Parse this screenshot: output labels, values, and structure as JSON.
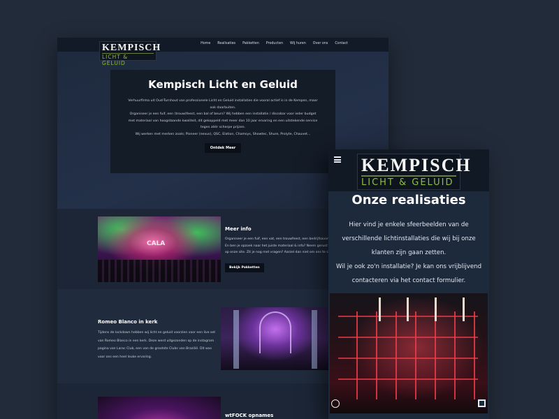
{
  "brand": {
    "logo_top": "KEMPISCH",
    "logo_bottom": "LICHT & GELUID"
  },
  "desktop": {
    "nav": [
      "Home",
      "Realisaties",
      "Pakketten",
      "Producten",
      "Wij huren",
      "Over ons",
      "Contact"
    ],
    "hero": {
      "title": "Kempisch Licht en Geluid",
      "paragraphs": [
        "Verhuurfirma uit Oud-Turnhout van professionele Licht en Geluid installaties die vooral actief is in de Kempen, maar",
        "ook daarbuiten.",
        "Organiseer je een fuif, een (trouw)feest, een bal of beurs? Wij hebben een installatie / discobar voor ieder budget",
        "met materiaal van hoogstaande kwaliteit, dit gekoppeld met meer dan 10 jaar ervaring en een uitstekende service",
        "tegen zéér scherpe prijzen.",
        "Wij werken met merken zoals; Pioneer (nexus), QSC, Elation, Chamsys, Showtec, Shure, Prolyte, Chauvet..."
      ],
      "button": "Ontdek Meer"
    },
    "section1": {
      "stage_text": "CALA",
      "title": "Meer info",
      "paragraphs": [
        "Organiseer je een fuif, een vat, een trouwfeest, een bedrijfsavond...",
        "En ben je opzoek naar het juiste materiaal & info? Neem gerust contact",
        "op onze site. Zit je nog met vragen? Aarzel dan niet om ons te contacteren."
      ],
      "button": "Bekijk Pakketten"
    },
    "section2": {
      "title": "Romeo Blanco in kerk",
      "paragraphs": [
        "Tijdens de lockdown hebben wij licht en geluid voorzien voor een live set",
        "van Romeo Blanco in een kerk. Deze werd uitgezonden op de instagram",
        "pagina van Larac Club, een van de grootste Clubs van Brazilië. Dit was",
        "voor ons een heel leuke ervaring."
      ]
    },
    "section3": {
      "title": "wtFOCK opnames"
    }
  },
  "mobile": {
    "menu_icon": "hamburger-icon",
    "title": "Onze realisaties",
    "paragraphs": [
      "Hier vind je enkele sfeerbeelden van de",
      "verschillende lichtinstallaties die wij bij onze",
      "klanten zijn gaan zetten.",
      "Wil je ook zo'n installatie? Je kan ons vrijblijvend",
      "contacteren via het contact formulier."
    ]
  },
  "colors": {
    "background": "#222b3a",
    "accent_green": "#8fbf3a",
    "card": "#141c28"
  }
}
